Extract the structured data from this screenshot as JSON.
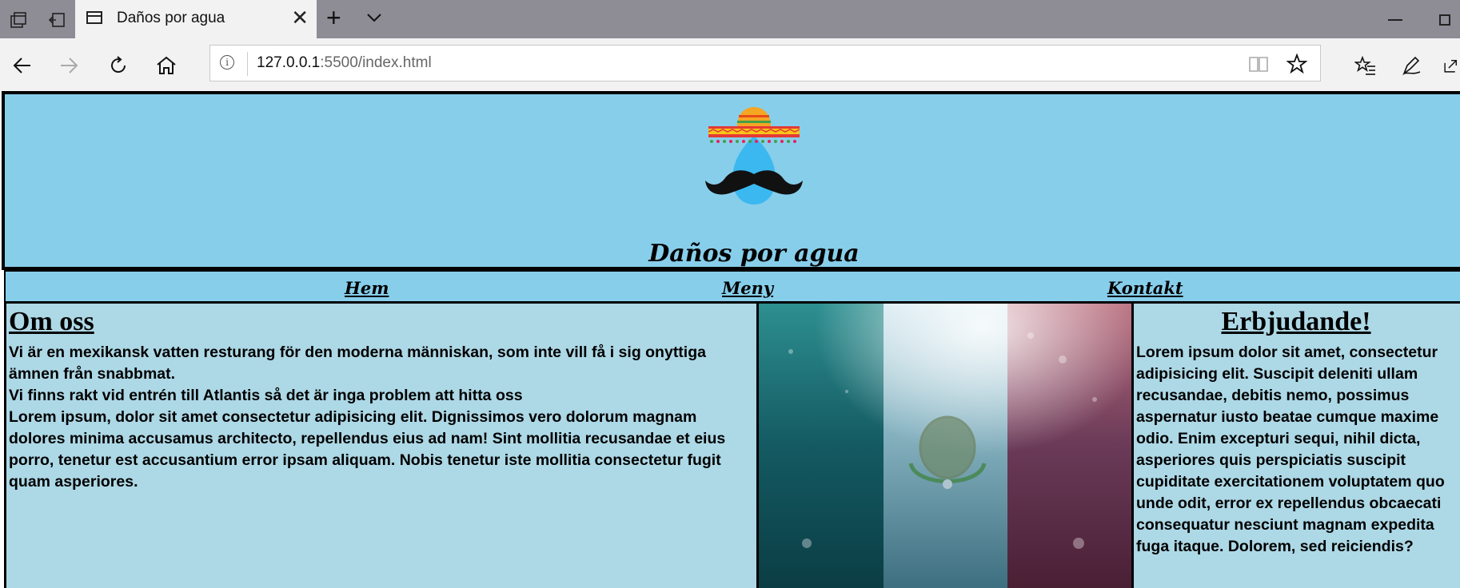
{
  "browser": {
    "tab_title": "Daños por agua",
    "url_host": "127.0.0.1",
    "url_rest": ":5500/index.html"
  },
  "site": {
    "title": "Daños por agua",
    "nav": [
      "Hem",
      "Meny",
      "Kontakt"
    ]
  },
  "about": {
    "heading": "Om oss",
    "paragraphs": [
      "Vi är en mexikansk vatten resturang för den moderna människan, som inte vill få i sig onyttiga ämnen från snabbmat.",
      "Vi finns rakt vid entrén till Atlantis så det är inga problem att hitta oss",
      "Lorem ipsum, dolor sit amet consectetur adipisicing elit. Dignissimos vero dolorum magnam dolores minima accusamus architecto, repellendus eius ad nam! Sint mollitia recusandae et eius porro, tenetur est accusantium error ipsam aliquam. Nobis tenetur iste mollitia consectetur fugit quam asperiores."
    ]
  },
  "offer": {
    "heading": "Erbjudande!",
    "lines": [
      "Lorem ipsum dolor sit amet, consectetur",
      "adipisicing elit. Suscipit deleniti ullam",
      "recusandae, debitis nemo, possimus",
      "aspernatur iusto beatae cumque maxime",
      "odio. Enim excepturi sequi, nihil dicta,",
      "asperiores quis perspiciatis suscipit",
      "cupiditate exercitationem voluptatem quo",
      "unde odit, error ex repellendus obcaecati",
      "consequatur nesciunt magnam expedita",
      "fuga itaque. Dolorem, sed reiciendis?"
    ]
  },
  "icons": [
    "tab-actions-icon",
    "set-aside-tabs-icon",
    "page-icon",
    "close-icon",
    "plus-icon",
    "chevron-down-icon",
    "back-icon",
    "forward-icon",
    "refresh-icon",
    "home-icon",
    "info-icon",
    "reading-view-icon",
    "star-icon",
    "favorites-icon",
    "pen-icon",
    "share-icon"
  ],
  "colors": {
    "header_bg": "#87ceeb",
    "content_bg": "#add8e6"
  }
}
